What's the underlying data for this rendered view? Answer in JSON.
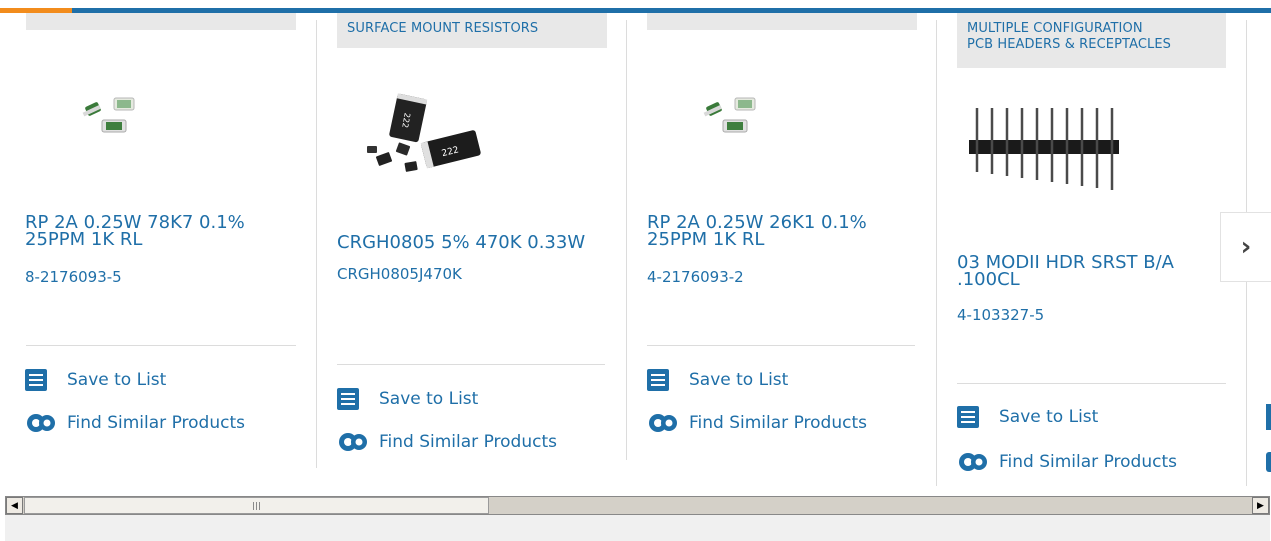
{
  "carousel": {
    "cards": [
      {
        "category": "",
        "title_line1": "RP 2A 0.25W 78K7 0.1%",
        "title_line2": "25PPM 1K RL",
        "part_number": "8-2176093-5",
        "save_label": "Save to List",
        "similar_label": "Find Similar Products"
      },
      {
        "category": "SURFACE MOUNT RESISTORS",
        "title_line1": "CRGH0805 5% 470K 0.33W",
        "title_line2": "",
        "part_number": "CRGH0805J470K",
        "save_label": "Save to List",
        "similar_label": "Find Similar Products"
      },
      {
        "category": "",
        "title_line1": "RP 2A 0.25W 26K1 0.1%",
        "title_line2": "25PPM 1K RL",
        "part_number": "4-2176093-2",
        "save_label": "Save to List",
        "similar_label": "Find Similar Products"
      },
      {
        "category_line1": "MULTIPLE CONFIGURATION",
        "category_line2": "PCB HEADERS & RECEPTACLES",
        "title_line1": "03 MODII HDR SRST B/A",
        "title_line2": ".100CL",
        "part_number": "4-103327-5",
        "save_label": "Save to List",
        "similar_label": "Find Similar Products"
      }
    ],
    "next_glyph": "›"
  },
  "colors": {
    "brand_blue": "#1f6fa8",
    "accent_orange": "#f28c1c",
    "tag_bg": "#e8e8e8"
  }
}
